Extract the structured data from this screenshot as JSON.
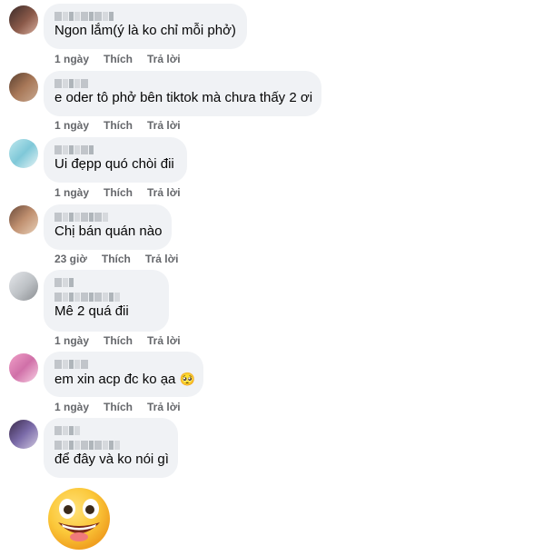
{
  "comments": [
    {
      "text": "Ngon lắm(ý là ko chỉ mỗi phở)",
      "time": "1 ngày",
      "like": "Thích",
      "reply": "Trả lời"
    },
    {
      "text": "e oder tô phở bên tiktok mà chưa thấy 2 ơi",
      "time": "1 ngày",
      "like": "Thích",
      "reply": "Trả lời"
    },
    {
      "text": "Ui đẹpp quó chòi đii",
      "time": "1 ngày",
      "like": "Thích",
      "reply": "Trả lời"
    },
    {
      "text": "Chị bán quán nào",
      "time": "23 giờ",
      "like": "Thích",
      "reply": "Trả lời"
    },
    {
      "text": "Mê 2 quá đii",
      "time": "1 ngày",
      "like": "Thích",
      "reply": "Trả lời"
    },
    {
      "text": "em xin acp đc ko ạa",
      "emoji": "🥺",
      "time": "1 ngày",
      "like": "Thích",
      "reply": "Trả lời"
    },
    {
      "text": "để đây và ko nói gì"
    }
  ],
  "colors": {
    "bubble_bg": "#f0f2f5",
    "meta_text": "#65676b",
    "body_text": "#050505"
  },
  "icons": [
    "avatar",
    "pleading-face-emoji",
    "grinning-face-emoji"
  ]
}
